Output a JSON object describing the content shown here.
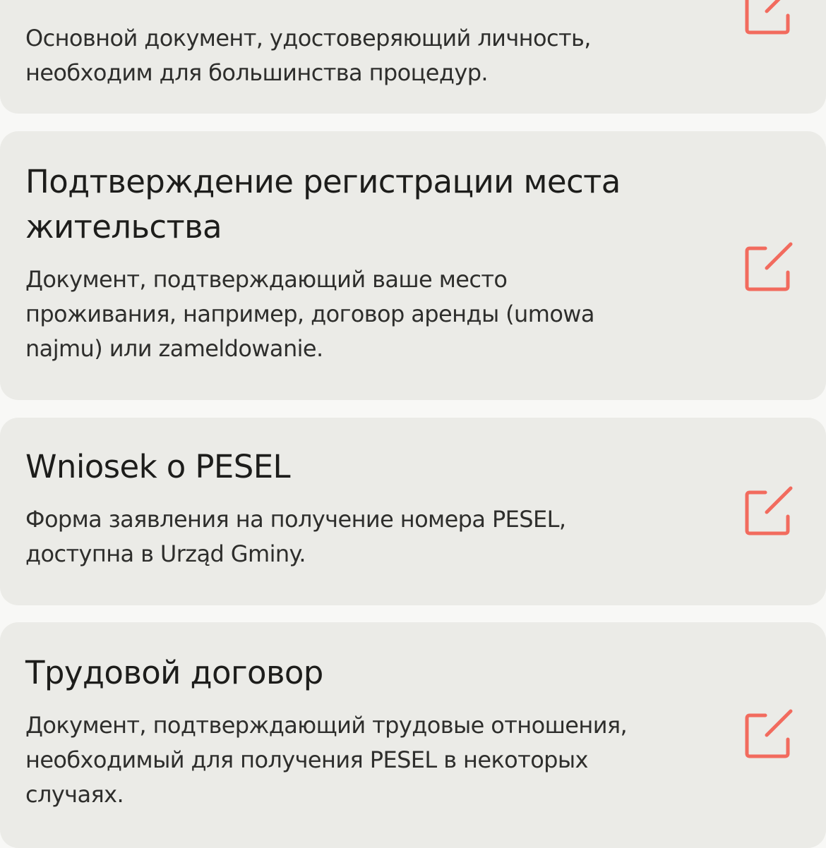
{
  "accent_color": "#f26b5e",
  "cards": [
    {
      "title": "",
      "description": "Основной документ, удостоверяющий личность, необходим для большинства процедур.",
      "action_icon": "edit-icon"
    },
    {
      "title": "Подтверждение регистрации места жительства",
      "description": "Документ, подтверждающий ваше место проживания, например, договор аренды (umowa najmu) или zameldowanie.",
      "action_icon": "edit-icon"
    },
    {
      "title": "Wniosek o PESEL",
      "description": "Форма заявления на получение номера PESEL, доступна в Urząd Gminy.",
      "action_icon": "edit-icon"
    },
    {
      "title": "Трудовой договор",
      "description": "Документ, подтверждающий трудовые отношения, необходимый для получения PESEL в некоторых случаях.",
      "action_icon": "edit-icon"
    }
  ]
}
